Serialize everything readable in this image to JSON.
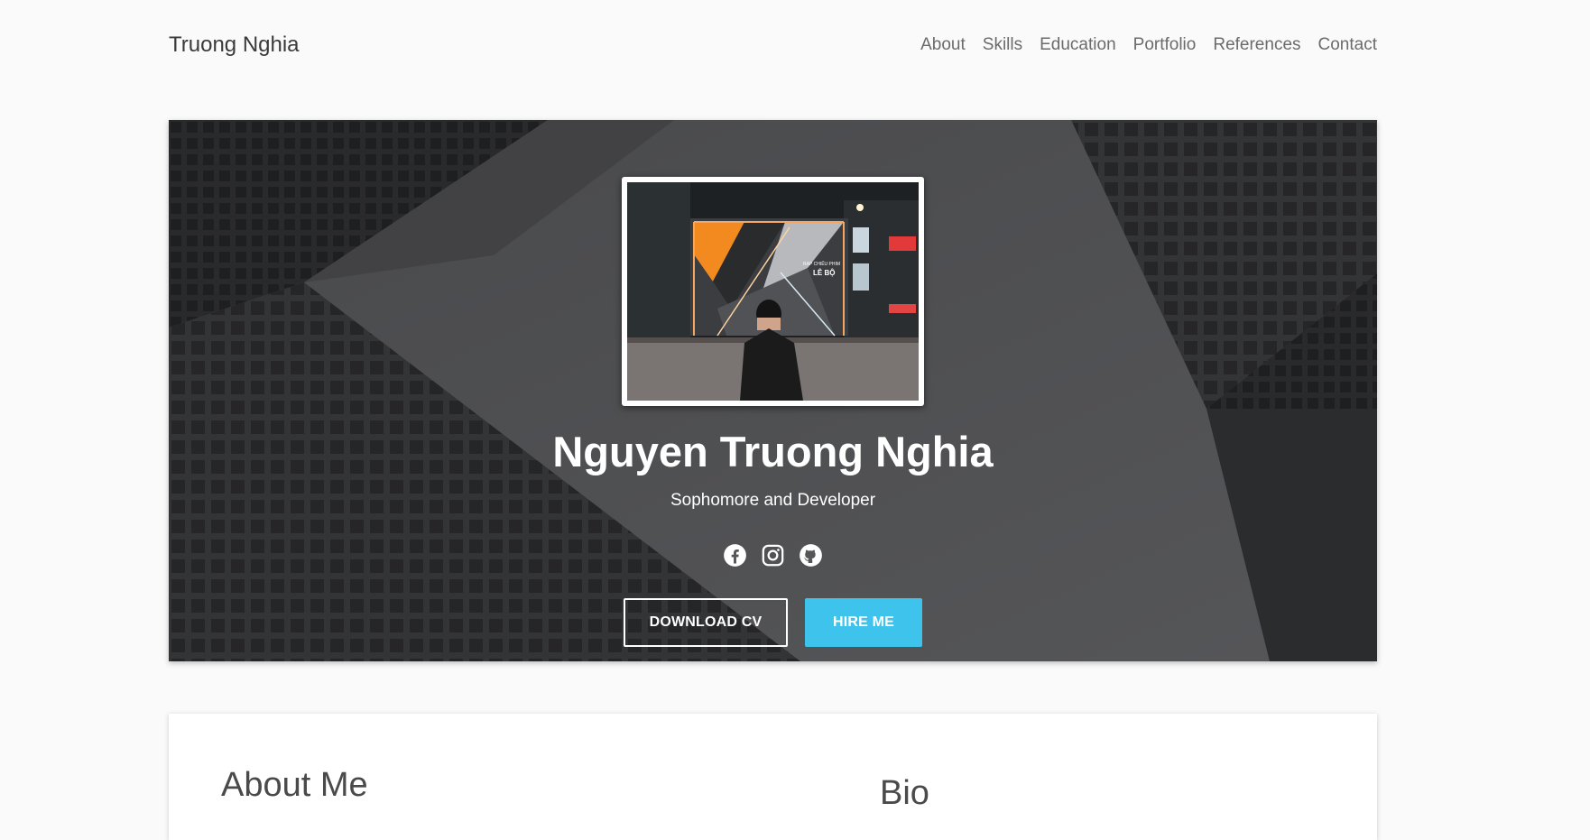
{
  "brand": "Truong Nghia",
  "nav": [
    {
      "label": "About"
    },
    {
      "label": "Skills"
    },
    {
      "label": "Education"
    },
    {
      "label": "Portfolio"
    },
    {
      "label": "References"
    },
    {
      "label": "Contact"
    }
  ],
  "hero": {
    "name": "Nguyen Truong Nghia",
    "subtitle": "Sophomore and Developer",
    "photo_sign_line1": "RẠP CHIẾU PHIM",
    "photo_sign_line2": "LÊ BỘ",
    "socials": [
      {
        "icon": "facebook-icon"
      },
      {
        "icon": "instagram-icon"
      },
      {
        "icon": "github-icon"
      }
    ],
    "download_cv_label": "DOWNLOAD CV",
    "hire_me_label": "HIRE ME"
  },
  "about": {
    "title": "About Me",
    "bio_title": "Bio"
  },
  "colors": {
    "accent": "#3ec4ec",
    "background": "#fafafa"
  }
}
